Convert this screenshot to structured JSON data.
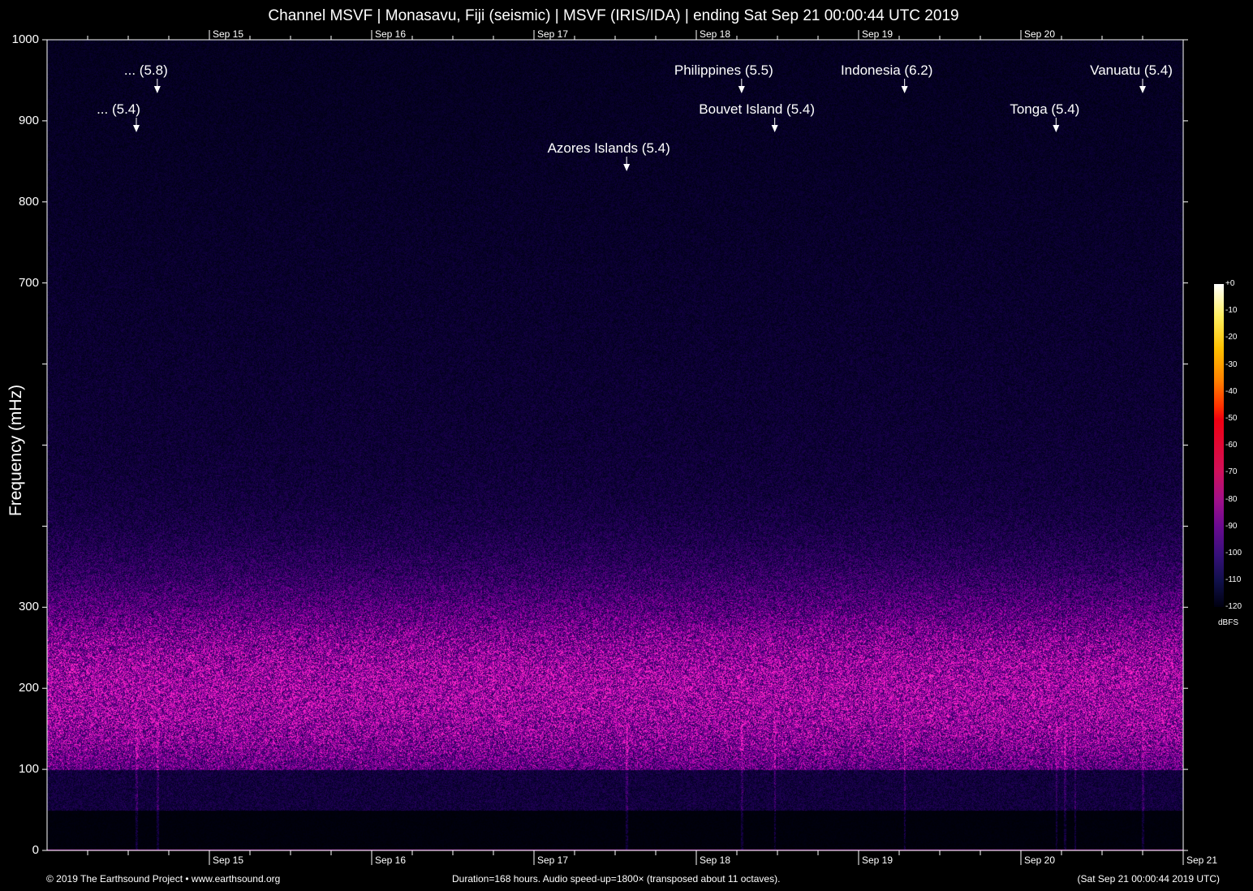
{
  "chart_data": {
    "type": "heatmap",
    "title": "Channel MSVF | Monasavu, Fiji (seismic) | MSVF (IRIS/IDA) | ending Sat Sep 21 00:00:44 UTC 2019",
    "ylabel": "Frequency (mHz)",
    "xlabel": "",
    "ylim": [
      0,
      1000
    ],
    "y_tick_labels": [
      {
        "value": 0,
        "label": "0"
      },
      {
        "value": 100,
        "label": "100"
      },
      {
        "value": 200,
        "label": "200"
      },
      {
        "value": 300,
        "label": "300"
      },
      {
        "value": 400,
        "label": ""
      },
      {
        "value": 500,
        "label": ""
      },
      {
        "value": 600,
        "label": ""
      },
      {
        "value": 700,
        "label": "700"
      },
      {
        "value": 800,
        "label": "800"
      },
      {
        "value": 900,
        "label": "900"
      },
      {
        "value": 1000,
        "label": "1000"
      }
    ],
    "x_range_hours": [
      0,
      168
    ],
    "x_tick_labels": [
      {
        "hour": 24,
        "label": "Sep 15"
      },
      {
        "hour": 48,
        "label": "Sep 16"
      },
      {
        "hour": 72,
        "label": "Sep 17"
      },
      {
        "hour": 96,
        "label": "Sep 18"
      },
      {
        "hour": 120,
        "label": "Sep 19"
      },
      {
        "hour": 144,
        "label": "Sep 20"
      },
      {
        "hour": 168,
        "label": "Sep 21"
      }
    ],
    "events": [
      {
        "hour": 16.3,
        "label": "... (5.8)"
      },
      {
        "hour": 13.2,
        "label": "... (5.4)"
      },
      {
        "hour": 85.7,
        "label": "Azores Islands (5.4)"
      },
      {
        "hour": 102.7,
        "label": "Philippines (5.5)"
      },
      {
        "hour": 107.6,
        "label": "Bouvet Island (5.4)"
      },
      {
        "hour": 126.8,
        "label": "Indonesia (6.2)"
      },
      {
        "hour": 149.2,
        "label": "Tonga (5.4)"
      },
      {
        "hour": 162.0,
        "label": "Vanuatu (5.4)"
      }
    ],
    "colorbar": {
      "unit": "dBFS",
      "ticks": [
        "+0",
        "-10",
        "-20",
        "-30",
        "-40",
        "-50",
        "-60",
        "-70",
        "-80",
        "-90",
        "-100",
        "-110",
        "-120"
      ]
    }
  },
  "footer": {
    "left": "© 2019 The Earthsound Project • www.earthsound.org",
    "center": "Duration=168 hours. Audio speed-up=1800× (transposed about 11 octaves).",
    "right": "(Sat Sep 21 00:00:44 2019 UTC)"
  }
}
